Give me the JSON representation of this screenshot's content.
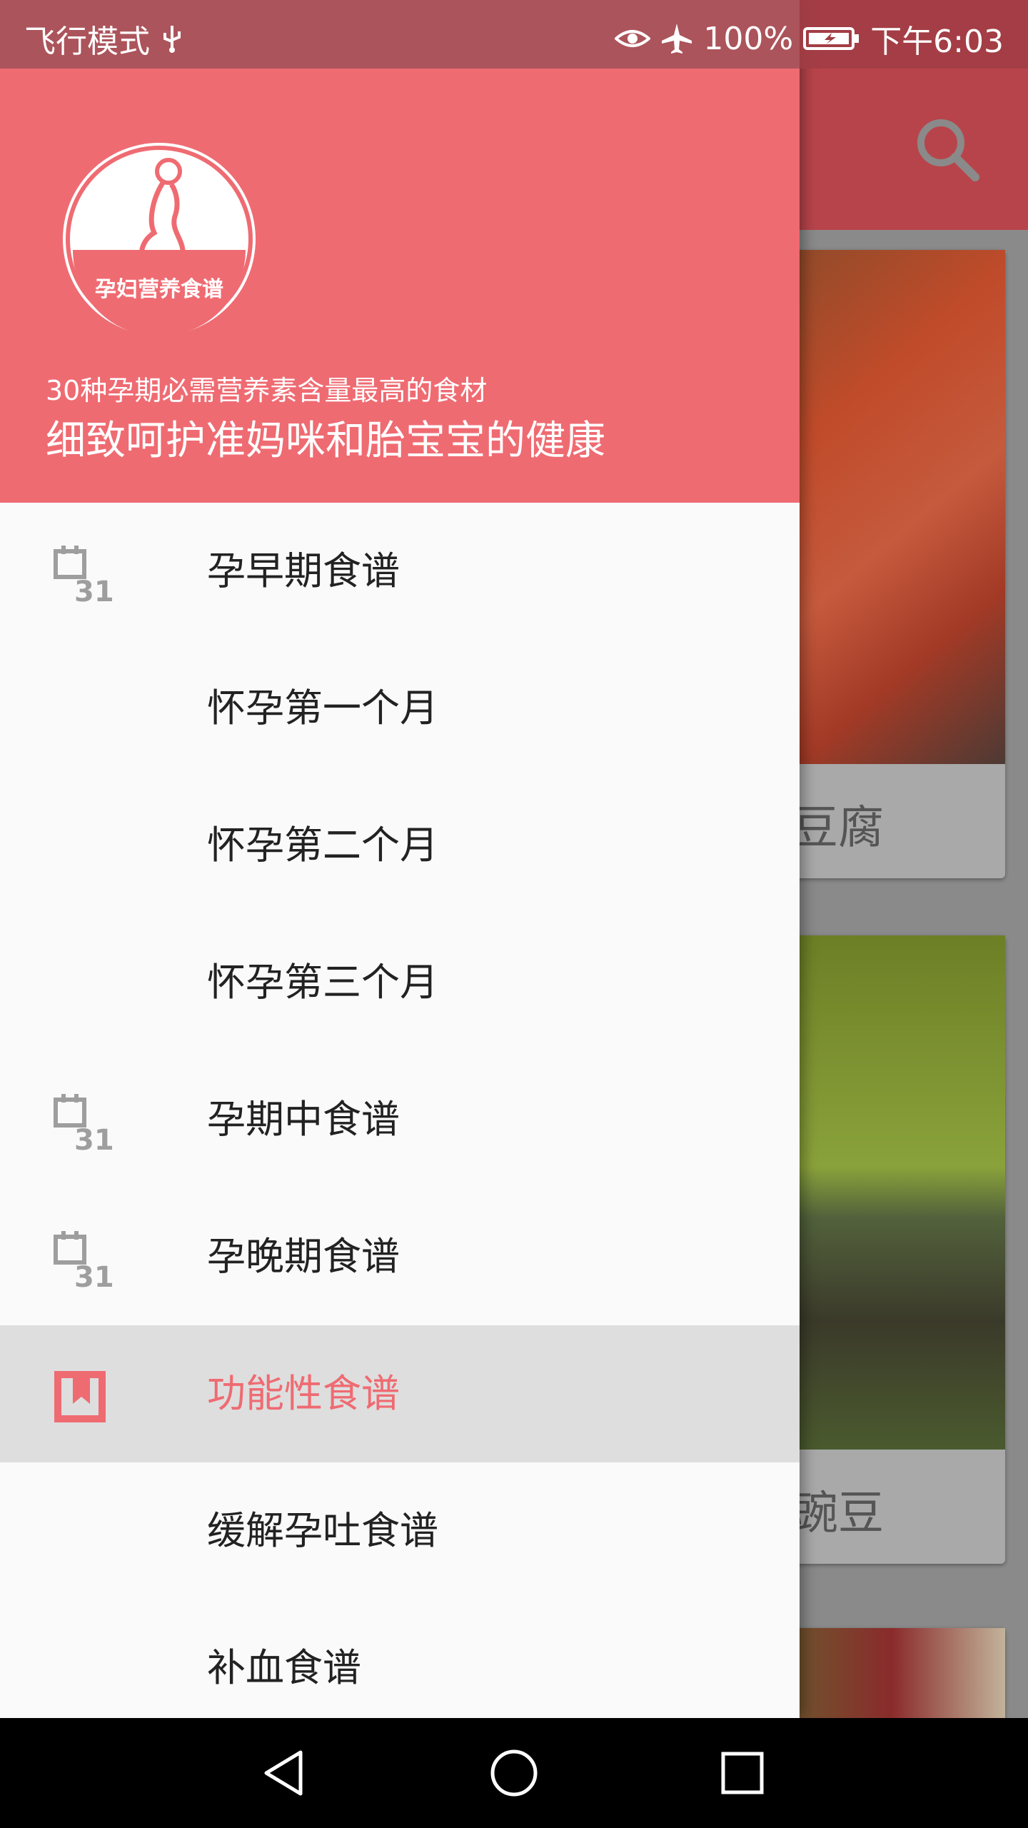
{
  "status_bar": {
    "left_text": "飞行模式",
    "battery": "100%",
    "time": "下午6:03",
    "icons": [
      "usb-icon",
      "eye-icon",
      "airplane-icon",
      "battery-charging-icon"
    ]
  },
  "background": {
    "cards": [
      {
        "title_fragment": "豆腐"
      },
      {
        "title_fragment": "豌豆"
      }
    ]
  },
  "drawer": {
    "logo_text": "孕妇营养食谱",
    "subtitle": "30种孕期必需营养素含量最高的食材",
    "title": "细致呵护准妈咪和胎宝宝的健康",
    "items": [
      {
        "label": "孕早期食谱",
        "icon": "calendar-31-icon"
      },
      {
        "label": "怀孕第一个月"
      },
      {
        "label": "怀孕第二个月"
      },
      {
        "label": "怀孕第三个月"
      },
      {
        "label": "孕期中食谱",
        "icon": "calendar-31-icon"
      },
      {
        "label": "孕晚期食谱",
        "icon": "calendar-31-icon"
      },
      {
        "label": "功能性食谱",
        "icon": "bookmark-icon",
        "active": true
      },
      {
        "label": "缓解孕吐食谱"
      },
      {
        "label": "补血食谱"
      }
    ]
  },
  "colors": {
    "accent": "#ef6b72",
    "toolbar": "#b8444b",
    "selected_bg": "#dedede"
  },
  "navigation_bar": {
    "buttons": [
      "back-icon",
      "home-icon",
      "recents-icon"
    ]
  }
}
